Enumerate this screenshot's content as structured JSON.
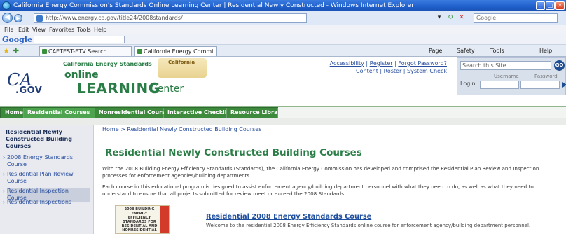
{
  "browser": {
    "title": "California Energy Commission's Standards Online Learning Center | Residential Newly Constructed - Windows Internet Explorer",
    "address": "http://www.energy.ca.gov/title24/2008standards/",
    "search_placeholder": "Google",
    "menu": [
      "File",
      "Edit",
      "View",
      "Favorites",
      "Tools",
      "Help"
    ],
    "google_label": "Google",
    "tabs": [
      "CAETEST-ETV Search",
      "California Energy Commi..."
    ],
    "toolbar_right": [
      "Page",
      "Safety",
      "Tools",
      "Help"
    ]
  },
  "header": {
    "logo_ca": "CA",
    "logo_gov": ".GOV",
    "subtitle": "California Energy Standards",
    "online": "online",
    "learning": "LEARNING",
    "center": "Center",
    "seal_text": "California",
    "top_links": {
      "accessibility": "Accessibility",
      "register": "Register",
      "forgot_password": "Forgot Password?",
      "content": "Content",
      "roster": "Roster",
      "system_check": "System Check"
    },
    "login": {
      "search_placeholder": "Search this Site",
      "go_label": "GO",
      "username_label": "Username",
      "password_label": "Password",
      "login_label": "Login:"
    }
  },
  "nav": {
    "tabs": [
      "Home",
      "Residential Courses",
      "Nonresidential Courses",
      "Interactive Checklists",
      "Resource Library"
    ],
    "active_index": 1
  },
  "sidebar": {
    "title": "Residential Newly Constructed Building Courses",
    "items": [
      "2008 Energy Standards Course",
      "Residential Plan Review Course",
      "Residential Inspection Course",
      "Residential Inspections"
    ]
  },
  "content": {
    "breadcrumb": {
      "home": "Home",
      "current": "Residential Newly Constructed Building Courses"
    },
    "title": "Residential Newly Constructed Building Courses",
    "para1": "With the 2008 Building Energy Efficiency Standards (Standards), the California Energy Commission has developed and comprised the Residential Plan Review and Inspection processes for enforcement agencies/building departments.",
    "para2": "Each course in this educational program is designed to assist enforcement agency/building department personnel with what they need to do, as well as what they need to understand to ensure that all projects submitted for review meet or exceed the 2008 Standards.",
    "thumbnail_text": "2008 BUILDING ENERGY EFFICIENCY STANDARDS FOR RESIDENTIAL AND NONRESIDENTIAL BUILDINGS",
    "course_link": "Residential 2008 Energy Standards Course",
    "course_desc": "Welcome to the residential 2008 Energy Efficiency Standards online course for enforcement agency/building department personnel."
  }
}
